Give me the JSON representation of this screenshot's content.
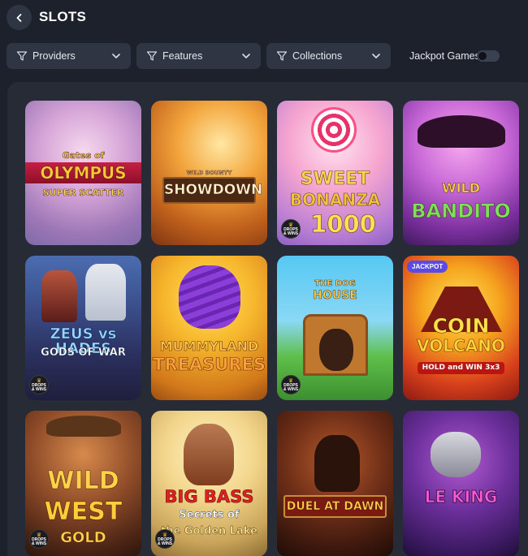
{
  "header": {
    "back_icon": "chevron-left-icon",
    "title": "SLOTS"
  },
  "filters": [
    {
      "label": "Providers",
      "icon": "filter-icon"
    },
    {
      "label": "Features",
      "icon": "filter-icon"
    },
    {
      "label": "Collections",
      "icon": "filter-icon"
    }
  ],
  "jackpot_toggle": {
    "label": "Jackpot Games",
    "enabled": false
  },
  "badges": {
    "drops_wins_line1": "DROPS",
    "drops_wins_line2": "& WINS",
    "jackpot": "JACKPOT"
  },
  "games": [
    {
      "line1": "Gates of",
      "line2": "OLYMPUS",
      "line3": "SUPER SCATTER",
      "badge": "none"
    },
    {
      "line1": "WILD BOUNTY",
      "line2": "SHOWDOWN",
      "line3": "",
      "badge": "none"
    },
    {
      "line1": "SWEET",
      "line2": "BONANZA",
      "line3": "1000",
      "badge": "drops-wins"
    },
    {
      "line1": "WILD",
      "line2": "BANDITO",
      "line3": "",
      "badge": "none"
    },
    {
      "line1": "ZEUS vs HADES",
      "line2": "GODS OF WAR",
      "line3": "",
      "badge": "drops-wins"
    },
    {
      "line1": "MUMMYLAND",
      "line2": "TREASURES",
      "line3": "",
      "badge": "none"
    },
    {
      "line1": "THE DOG",
      "line2": "HOUSE",
      "line3": "",
      "badge": "drops-wins"
    },
    {
      "line1": "COIN",
      "line2": "VOLCANO",
      "line3": "HOLD and WIN 3x3",
      "badge": "jackpot"
    },
    {
      "line1": "WILD",
      "line2": "WEST",
      "line3": "GOLD",
      "badge": "drops-wins"
    },
    {
      "line1": "BIG BASS",
      "line2": "Secrets of",
      "line3": "the Golden Lake",
      "badge": "drops-wins"
    },
    {
      "line1": "DUEL AT DAWN",
      "line2": "",
      "line3": "",
      "badge": "none"
    },
    {
      "line1": "LE KING",
      "line2": "",
      "line3": "",
      "badge": "none"
    }
  ]
}
